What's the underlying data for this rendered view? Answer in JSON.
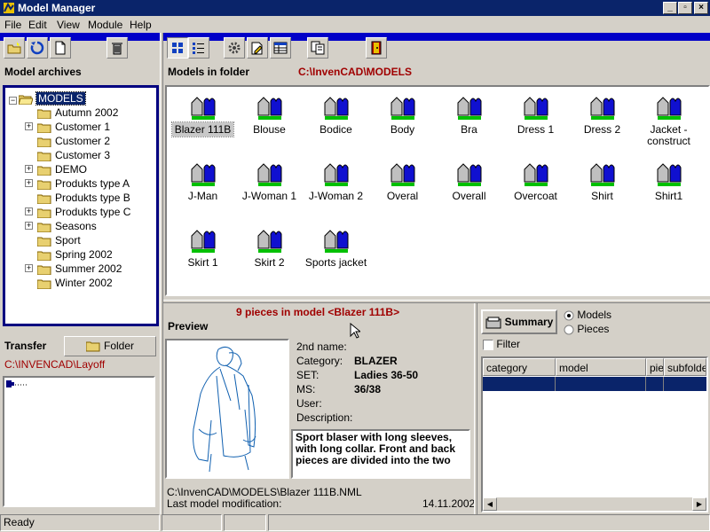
{
  "window": {
    "title": "Model Manager"
  },
  "menu": [
    "File",
    "Edit",
    "View",
    "Module",
    "Help"
  ],
  "archives": {
    "label": "Model archives",
    "root": "MODELS",
    "folders": [
      {
        "name": "Autumn 2002",
        "expandable": false
      },
      {
        "name": "Customer 1",
        "expandable": true
      },
      {
        "name": "Customer 2",
        "expandable": false
      },
      {
        "name": "Customer 3",
        "expandable": false
      },
      {
        "name": "DEMO",
        "expandable": true
      },
      {
        "name": "Produkts type A",
        "expandable": true
      },
      {
        "name": "Produkts type B",
        "expandable": false
      },
      {
        "name": "Produkts type C",
        "expandable": true
      },
      {
        "name": "Seasons",
        "expandable": true
      },
      {
        "name": "Sport",
        "expandable": false
      },
      {
        "name": "Spring 2002",
        "expandable": false
      },
      {
        "name": "Summer 2002",
        "expandable": true
      },
      {
        "name": "Winter 2002",
        "expandable": false
      }
    ]
  },
  "folder": {
    "label": "Models in folder",
    "path": "C:\\InvenCAD\\MODELS",
    "models": [
      "Blazer 111B",
      "Blouse",
      "Bodice",
      "Body",
      "Bra",
      "Dress 1",
      "Dress 2",
      "Jacket - construct",
      "J-Man",
      "J-Woman 1",
      "J-Woman 2",
      "Overal",
      "Overall",
      "Overcoat",
      "Shirt",
      "Shirt1",
      "Skirt 1",
      "Skirt 2",
      "Sports jacket"
    ],
    "selected": "Blazer 111B"
  },
  "transfer": {
    "label": "Transfer",
    "button": "Folder",
    "path": "C:\\INVENCAD\\Layoff"
  },
  "preview": {
    "label": "Preview",
    "pieces_text": "9 pieces in model <Blazer 111B>",
    "fields": [
      {
        "label": "2nd name:",
        "value": ""
      },
      {
        "label": "Category:",
        "value": "BLAZER"
      },
      {
        "label": "SET:",
        "value": "Ladies 36-50"
      },
      {
        "label": "MS:",
        "value": "36/38"
      },
      {
        "label": "User:",
        "value": ""
      },
      {
        "label": "Description:",
        "value": ""
      }
    ],
    "description": "Sport blaser with long sleeves, with long collar. Front and back pieces are divided into the two",
    "file_path": "C:\\InvenCAD\\MODELS\\Blazer 111B.NML",
    "mod_label": "Last model modification:",
    "mod_date": "14.11.2002"
  },
  "summary": {
    "button": "Summary",
    "options": [
      "Models",
      "Pieces"
    ],
    "selected": "Models",
    "filter": "Filter",
    "columns": [
      "category",
      "model",
      "pie",
      "subfolder"
    ]
  },
  "status": {
    "text": "Ready"
  },
  "colors": {
    "title": "#0a246a",
    "accent": "#0000c8",
    "path_red": "#a00000",
    "selection": "#0a246a"
  }
}
